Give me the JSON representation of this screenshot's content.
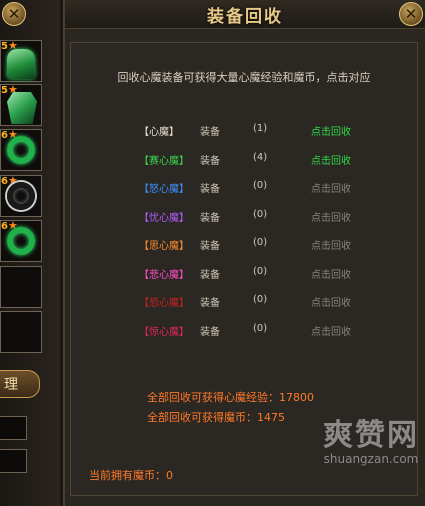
{
  "left_panel": {
    "close_icon": "close-icon",
    "slots": [
      {
        "level": "5",
        "item": "helm",
        "color": "#28a046"
      },
      {
        "level": "5",
        "item": "armor",
        "color": "#28a046"
      },
      {
        "level": "6",
        "item": "ring-green",
        "color": "#1fb14a"
      },
      {
        "level": "6",
        "item": "ring-dark",
        "color": "#1a1a1a"
      },
      {
        "level": "6",
        "item": "ring-green",
        "color": "#1fb14a"
      }
    ],
    "sort_button_label": "理"
  },
  "panel": {
    "title": "装备回收",
    "close_icon": "close-icon",
    "intro_text": "回收心魔装备可获得大量心魔经验和魔币，点击对应",
    "rows": [
      {
        "name": "【心魔】",
        "name_color": "#e6e0d2",
        "kind": "装备",
        "count": "(1)",
        "action": "点击回收",
        "active": true
      },
      {
        "name": "【赛心魔】",
        "name_color": "#39d64c",
        "kind": "装备",
        "count": "(4)",
        "action": "点击回收",
        "active": true
      },
      {
        "name": "【怒心魔】",
        "name_color": "#3d8fff",
        "kind": "装备",
        "count": "(0)",
        "action": "点击回收",
        "active": false
      },
      {
        "name": "【忧心魔】",
        "name_color": "#b55cff",
        "kind": "装备",
        "count": "(0)",
        "action": "点击回收",
        "active": false
      },
      {
        "name": "【思心魔】",
        "name_color": "#ff8c2a",
        "kind": "装备",
        "count": "(0)",
        "action": "点击回收",
        "active": false
      },
      {
        "name": "【悲心魔】",
        "name_color": "#ff4fc8",
        "kind": "装备",
        "count": "(0)",
        "action": "点击回收",
        "active": false
      },
      {
        "name": "【恐心魔】",
        "name_color": "#c8231f",
        "kind": "装备",
        "count": "(0)",
        "action": "点击回收",
        "active": false
      },
      {
        "name": "【惊心魔】",
        "name_color": "#e0255a",
        "kind": "装备",
        "count": "(0)",
        "action": "点击回收",
        "active": false
      }
    ],
    "summary_exp": "全部回收可获得心魔经验：17800",
    "summary_coin": "全部回收可获得魔币：1475",
    "current_coin": "当前拥有魔币：0"
  },
  "watermark": {
    "main": "爽赞网",
    "sub": "shuangzan.com"
  }
}
